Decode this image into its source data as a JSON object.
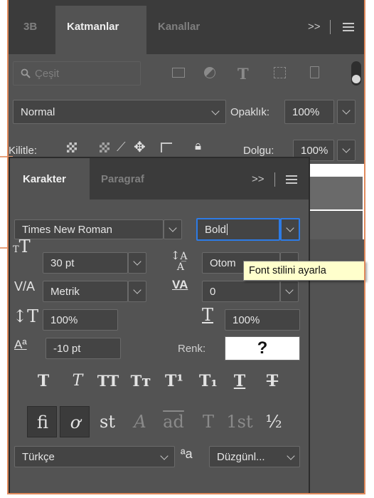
{
  "colors": {
    "panel_bg": "#535353",
    "tab_bar_bg": "#3b3b3b",
    "field_bg": "#444444",
    "focus_blue": "#2d7be5",
    "tooltip_bg": "#ffffcc",
    "swatch": "#ffffff"
  },
  "layers_panel": {
    "tabs": [
      "3B",
      "Katmanlar",
      "Kanallar"
    ],
    "active_tab": "Katmanlar",
    "overflow": ">>",
    "filter_placeholder": "Çeşit",
    "blend_mode": "Normal",
    "opacity_label": "Opaklık:",
    "opacity_value": "100%",
    "lock_label": "Kilitle:",
    "fill_label": "Dolgu:",
    "fill_value": "100%"
  },
  "char_panel": {
    "tabs": [
      "Karakter",
      "Paragraf"
    ],
    "active_tab": "Karakter",
    "overflow": ">>",
    "font_family": "Times New Roman",
    "font_style": "Bold",
    "font_size": "30 pt",
    "leading": "Otom",
    "kerning": "Metrik",
    "tracking": "0",
    "vertical_scale": "100%",
    "horizontal_scale": "100%",
    "baseline_shift": "-10 pt",
    "color_label": "Renk:",
    "color_swatch_mark": "?",
    "language": "Türkçe",
    "antialias": "Düzgünl...",
    "aa_icon": "ªa"
  },
  "tooltip": {
    "text": "Font stilini ayarla"
  },
  "type_styles": [
    "T",
    "T",
    "TT",
    "Tт",
    "T¹",
    "T₁",
    "T",
    "T"
  ],
  "opentype": [
    "fi",
    "ơ",
    "st",
    "A",
    "ad",
    "T",
    "1st",
    "½"
  ]
}
